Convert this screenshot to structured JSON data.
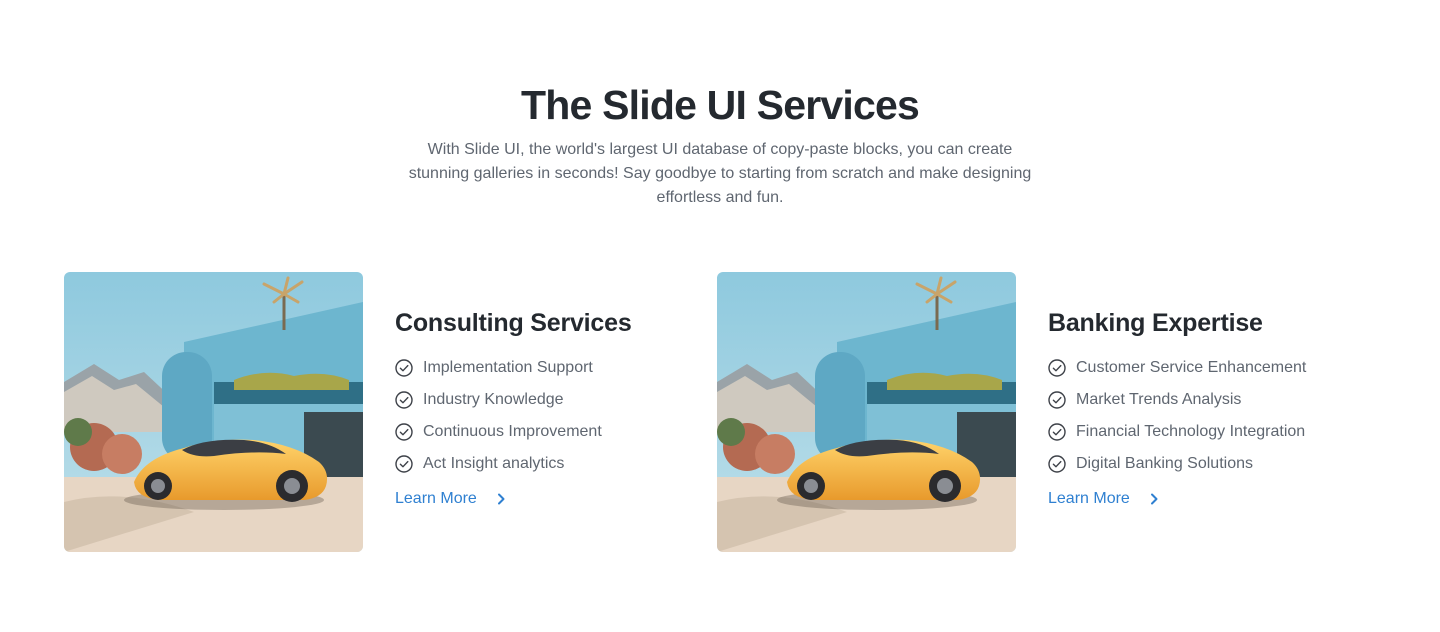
{
  "hero": {
    "title": "The Slide UI Services",
    "subtitle": "With Slide UI, the world's largest UI database of copy-paste blocks, you can create stunning galleries in seconds! Say goodbye to starting from scratch and make designing effortless and fun."
  },
  "cards": [
    {
      "title": "Consulting Services",
      "items": [
        "Implementation Support",
        "Industry Knowledge",
        "Continuous Improvement",
        "Act Insight analytics"
      ],
      "link_label": "Learn More"
    },
    {
      "title": "Banking Expertise",
      "items": [
        "Customer Service Enhancement",
        "Market Trends Analysis",
        "Financial Technology Integration",
        "Digital Banking Solutions"
      ],
      "link_label": "Learn More"
    }
  ],
  "icons": {
    "check": "check-circle-icon",
    "chevron": "chevron-right-icon"
  },
  "colors": {
    "heading": "#24292f",
    "body": "#5f6670",
    "link": "#2f80d1"
  }
}
